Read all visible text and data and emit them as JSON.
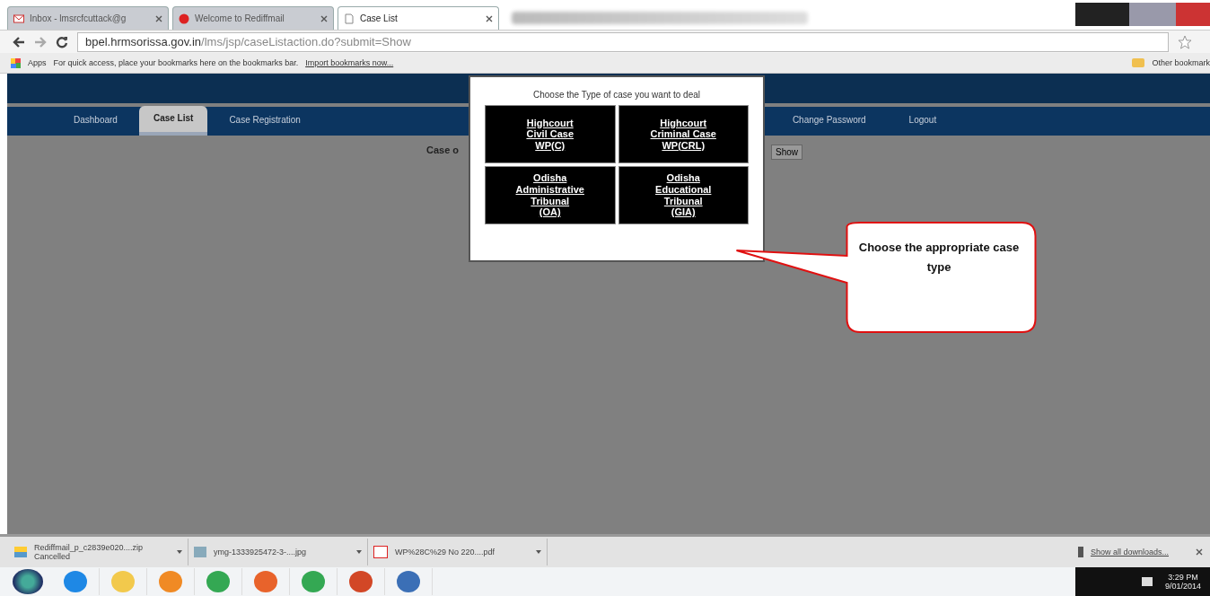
{
  "browser": {
    "tabs": [
      {
        "title": "Inbox - lmsrcfcuttack@g",
        "selected": false
      },
      {
        "title": "Welcome to Rediffmail",
        "selected": false
      },
      {
        "title": "Case List",
        "selected": true
      }
    ],
    "url_host": "bpel.hrmsorissa.gov.in",
    "url_path": "/lms/jsp/caseListaction.do?submit=Show",
    "bookmarks": {
      "apps": "Apps",
      "hint": "For quick access, place your bookmarks here on the bookmarks bar.",
      "import_link": "Import bookmarks now...",
      "other": "Other bookmark"
    }
  },
  "nav": [
    {
      "label": "Dashboard",
      "selected": false
    },
    {
      "label": "Case List",
      "selected": true
    },
    {
      "label": "Case Registration",
      "selected": false
    },
    {
      "label": "Change Password",
      "selected": false
    },
    {
      "label": "Logout",
      "selected": false
    }
  ],
  "content": {
    "label": "Case o",
    "button": "Show"
  },
  "dialog": {
    "title": "Choose the Type of case you want to deal",
    "options": [
      {
        "lines": [
          "Highcourt",
          "Civil Case",
          "WP(C)"
        ]
      },
      {
        "lines": [
          "Highcourt",
          "Criminal Case",
          "WP(CRL)"
        ]
      },
      {
        "lines": [
          "Odisha",
          "Administrative",
          "Tribunal",
          "(OA)"
        ]
      },
      {
        "lines": [
          "Odisha",
          "Educational",
          "Tribunal",
          "(GIA)"
        ]
      }
    ]
  },
  "callout": {
    "text": "Choose the appropriate case type"
  },
  "downloads": {
    "items": [
      {
        "name": "Rediffmail_p_c2839e020....zip",
        "status": "Cancelled",
        "kind": "zip"
      },
      {
        "name": "ymg-1333925472-3-....jpg",
        "kind": "image"
      },
      {
        "name": "WP%28C%29 No 220....pdf",
        "kind": "pdf"
      }
    ],
    "show_all": "Show all downloads..."
  },
  "taskbar": {
    "apps": [
      {
        "kind": "ie"
      },
      {
        "kind": "folder"
      },
      {
        "kind": "media"
      },
      {
        "kind": "chrome"
      },
      {
        "kind": "firefox"
      },
      {
        "kind": "chrome"
      },
      {
        "kind": "powerpoint"
      },
      {
        "kind": "window"
      }
    ],
    "time": "3:29 PM",
    "date": "9/01/2014"
  }
}
